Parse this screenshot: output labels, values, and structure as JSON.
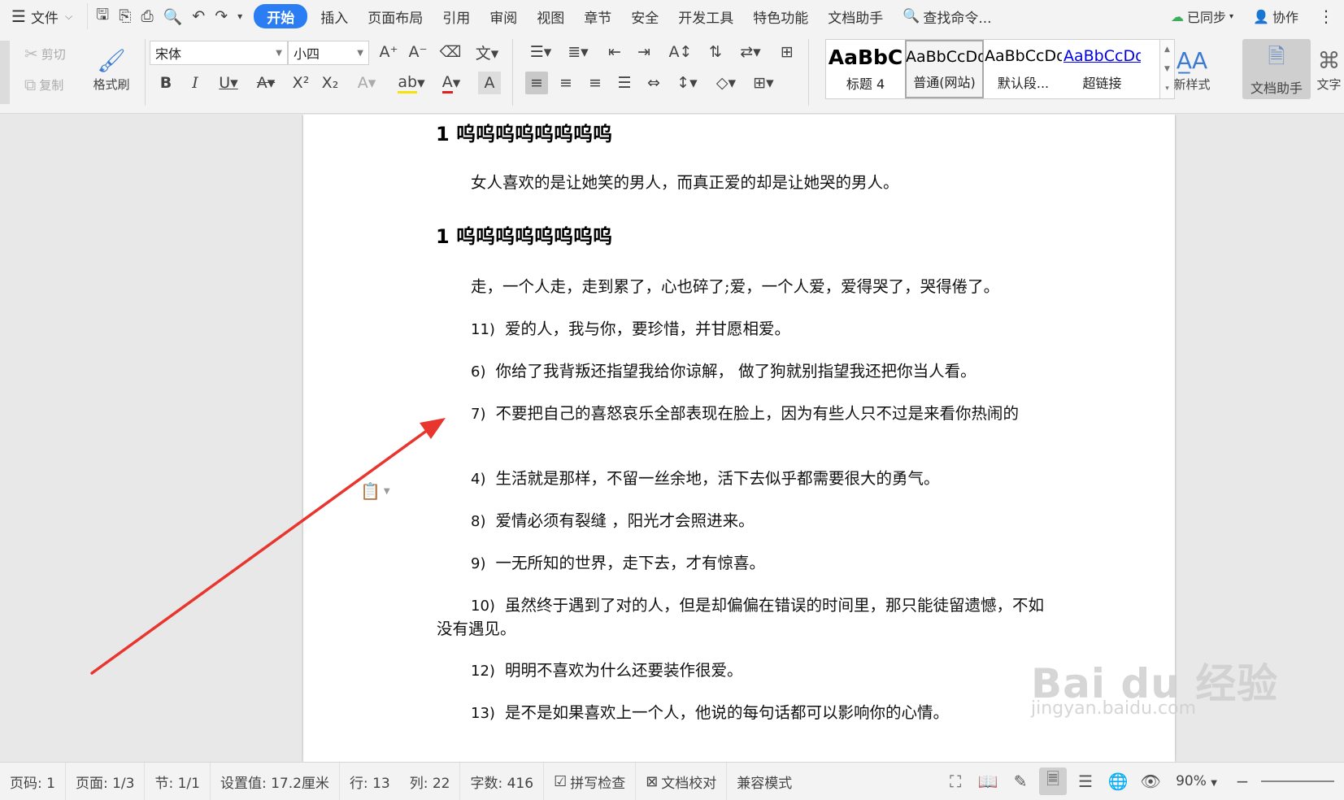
{
  "menubar": {
    "file": "文件",
    "tabs": [
      "开始",
      "插入",
      "页面布局",
      "引用",
      "审阅",
      "视图",
      "章节",
      "安全",
      "开发工具",
      "特色功能",
      "文档助手"
    ],
    "search": "查找命令...",
    "sync": "已同步",
    "collab": "协作"
  },
  "ribbon": {
    "cut": "剪切",
    "copy": "复制",
    "format_painter": "格式刷",
    "font_name": "宋体",
    "font_size": "小四",
    "styles": [
      {
        "sample": "AaBbC",
        "name": "标题 4"
      },
      {
        "sample": "AaBbCcDd",
        "name": "普通(网站)"
      },
      {
        "sample": "AaBbCcDd",
        "name": "默认段..."
      },
      {
        "sample": "AaBbCcDd",
        "name": "超链接"
      }
    ],
    "new_style": "新样式",
    "doc_helper": "文档助手",
    "text_tool": "文字"
  },
  "document": {
    "heading1": "1 呜呜呜呜呜呜呜呜",
    "para1": "女人喜欢的是让她笑的男人，而真正爱的却是让她哭的男人。",
    "heading2": "1 呜呜呜呜呜呜呜呜",
    "para2": "走，一个人走，走到累了，心也碎了;爱，一个人爱，爱得哭了，哭得倦了。",
    "items": [
      {
        "num": "11)",
        "text": "爱的人，我与你，要珍惜，并甘愿相爱。"
      },
      {
        "num": "6)",
        "text": "你给了我背叛还指望我给你谅解，  做了狗就别指望我还把你当人看。"
      },
      {
        "num": "7)",
        "text": "不要把自己的喜怒哀乐全部表现在脸上，因为有些人只不过是来看你热闹的"
      },
      {
        "num": "4)",
        "text": "生活就是那样，不留一丝余地，活下去似乎都需要很大的勇气。"
      },
      {
        "num": "8)",
        "text": "爱情必须有裂缝  ，阳光才会照进来。"
      },
      {
        "num": "9)",
        "text": "一无所知的世界，走下去，才有惊喜。"
      },
      {
        "num": "10)",
        "text": "虽然终于遇到了对的人，但是却偏偏在错误的时间里，那只能徒留遗憾，不如没有遇见。"
      },
      {
        "num": "12)",
        "text": "明明不喜欢为什么还要装作很爱。"
      },
      {
        "num": "13)",
        "text": "是不是如果喜欢上一个人，他说的每句话都可以影响你的心情。"
      }
    ],
    "watermark": "Bai du 经验",
    "watermark_sub": "jingyan.baidu.com"
  },
  "statusbar": {
    "page_code": "页码: 1",
    "page": "页面: 1/3",
    "section": "节: 1/1",
    "setting": "设置值: 17.2厘米",
    "row": "行: 13",
    "col": "列: 22",
    "word_count": "字数: 416",
    "spell_check": "拼写检查",
    "doc_proof": "文档校对",
    "compat": "兼容模式",
    "zoom": "90%"
  },
  "colors": {
    "accent": "#2b7df3",
    "annotation_arrow": "#e8352e"
  }
}
